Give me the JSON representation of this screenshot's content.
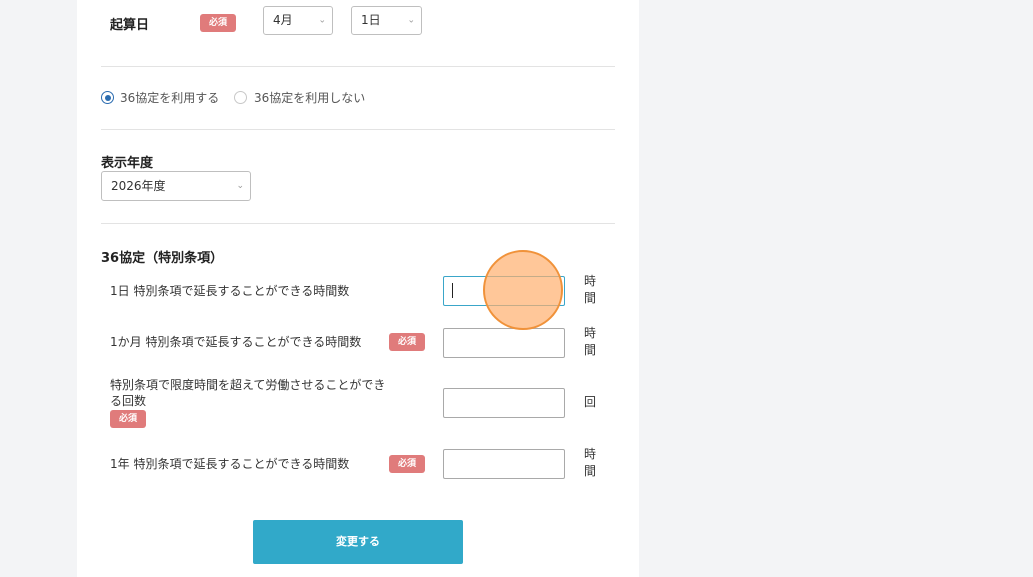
{
  "kisanbi": {
    "label": "起算日",
    "required_badge": "必須",
    "month_value": "4月",
    "day_value": "1日"
  },
  "agreement_radio": {
    "option_use": "36協定を利用する",
    "option_not_use": "36協定を利用しない",
    "selected": "option_use"
  },
  "display_year": {
    "label": "表示年度",
    "value": "2026年度"
  },
  "special_clause": {
    "section_title": "36協定（特別条項）",
    "rows": [
      {
        "label": "1日 特別条項で延長することができる時間数",
        "required": false,
        "value": "",
        "unit": "時間"
      },
      {
        "label": "1か月 特別条項で延長することができる時間数",
        "required": true,
        "badge": "必須",
        "value": "",
        "unit": "時間"
      },
      {
        "label": "特別条項で限度時間を超えて労働させることができる回数",
        "required": true,
        "badge": "必須",
        "value": "",
        "unit": "回"
      },
      {
        "label": "1年 特別条項で延長することができる時間数",
        "required": true,
        "badge": "必須",
        "value": "",
        "unit": "時間"
      }
    ]
  },
  "submit_label": "変更する",
  "icons": {
    "select_chevron": "chevron-down-icon"
  },
  "colors": {
    "required_badge": "#e07b7b",
    "submit_button": "#31a9c9",
    "radio_selected": "#2b6cb0",
    "focus_border": "#3aa6c9",
    "click_indicator": "#f0923a"
  }
}
